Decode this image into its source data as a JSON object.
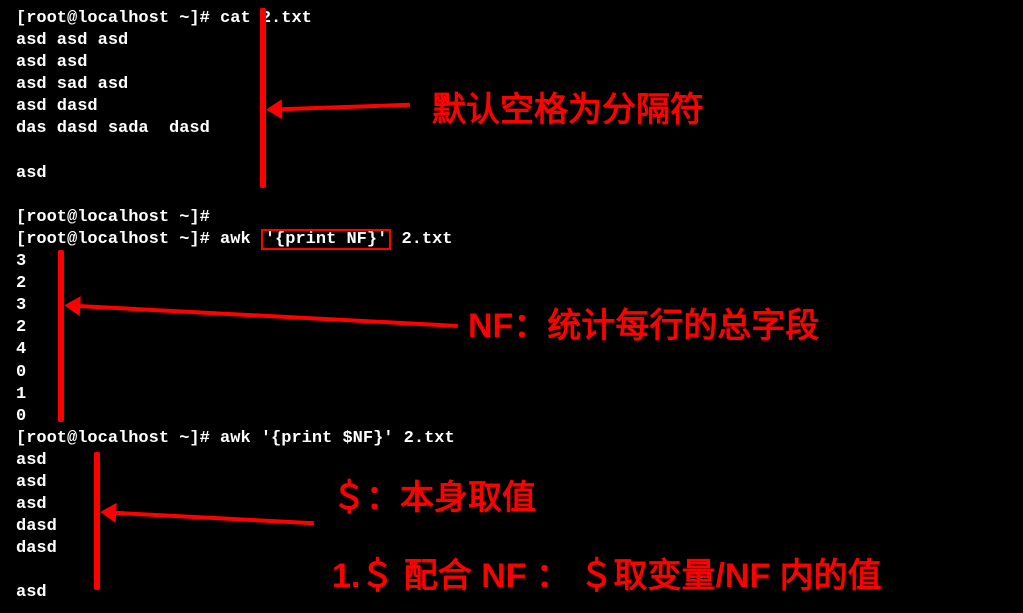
{
  "prompt": "[root@localhost ~]#",
  "block1": {
    "cmd_parts": {
      "pre": " cat",
      "file": " 2.txt"
    },
    "out": [
      "asd asd asd",
      "asd asd",
      "asd sad asd",
      "asd dasd",
      "das dasd sada  dasd",
      "",
      "asd"
    ]
  },
  "block2": {
    "cmd_parts": {
      "pre": " awk ",
      "boxed": "'{print NF}'",
      "post": " 2.txt"
    },
    "out": [
      "3",
      "2",
      "3",
      "2",
      "4",
      "0",
      "1",
      "0"
    ]
  },
  "block3": {
    "cmd": " awk '{print $NF}' 2.txt",
    "out": [
      "asd",
      "asd",
      "asd",
      "dasd",
      "dasd",
      "",
      "asd"
    ]
  },
  "annotations": {
    "a1": "默认空格为分隔符",
    "a2": "NF：统计每行的总字段",
    "a3": "＄：本身取值",
    "a4": "1.＄ 配合 NF ： ＄取变量/NF 内的值"
  }
}
